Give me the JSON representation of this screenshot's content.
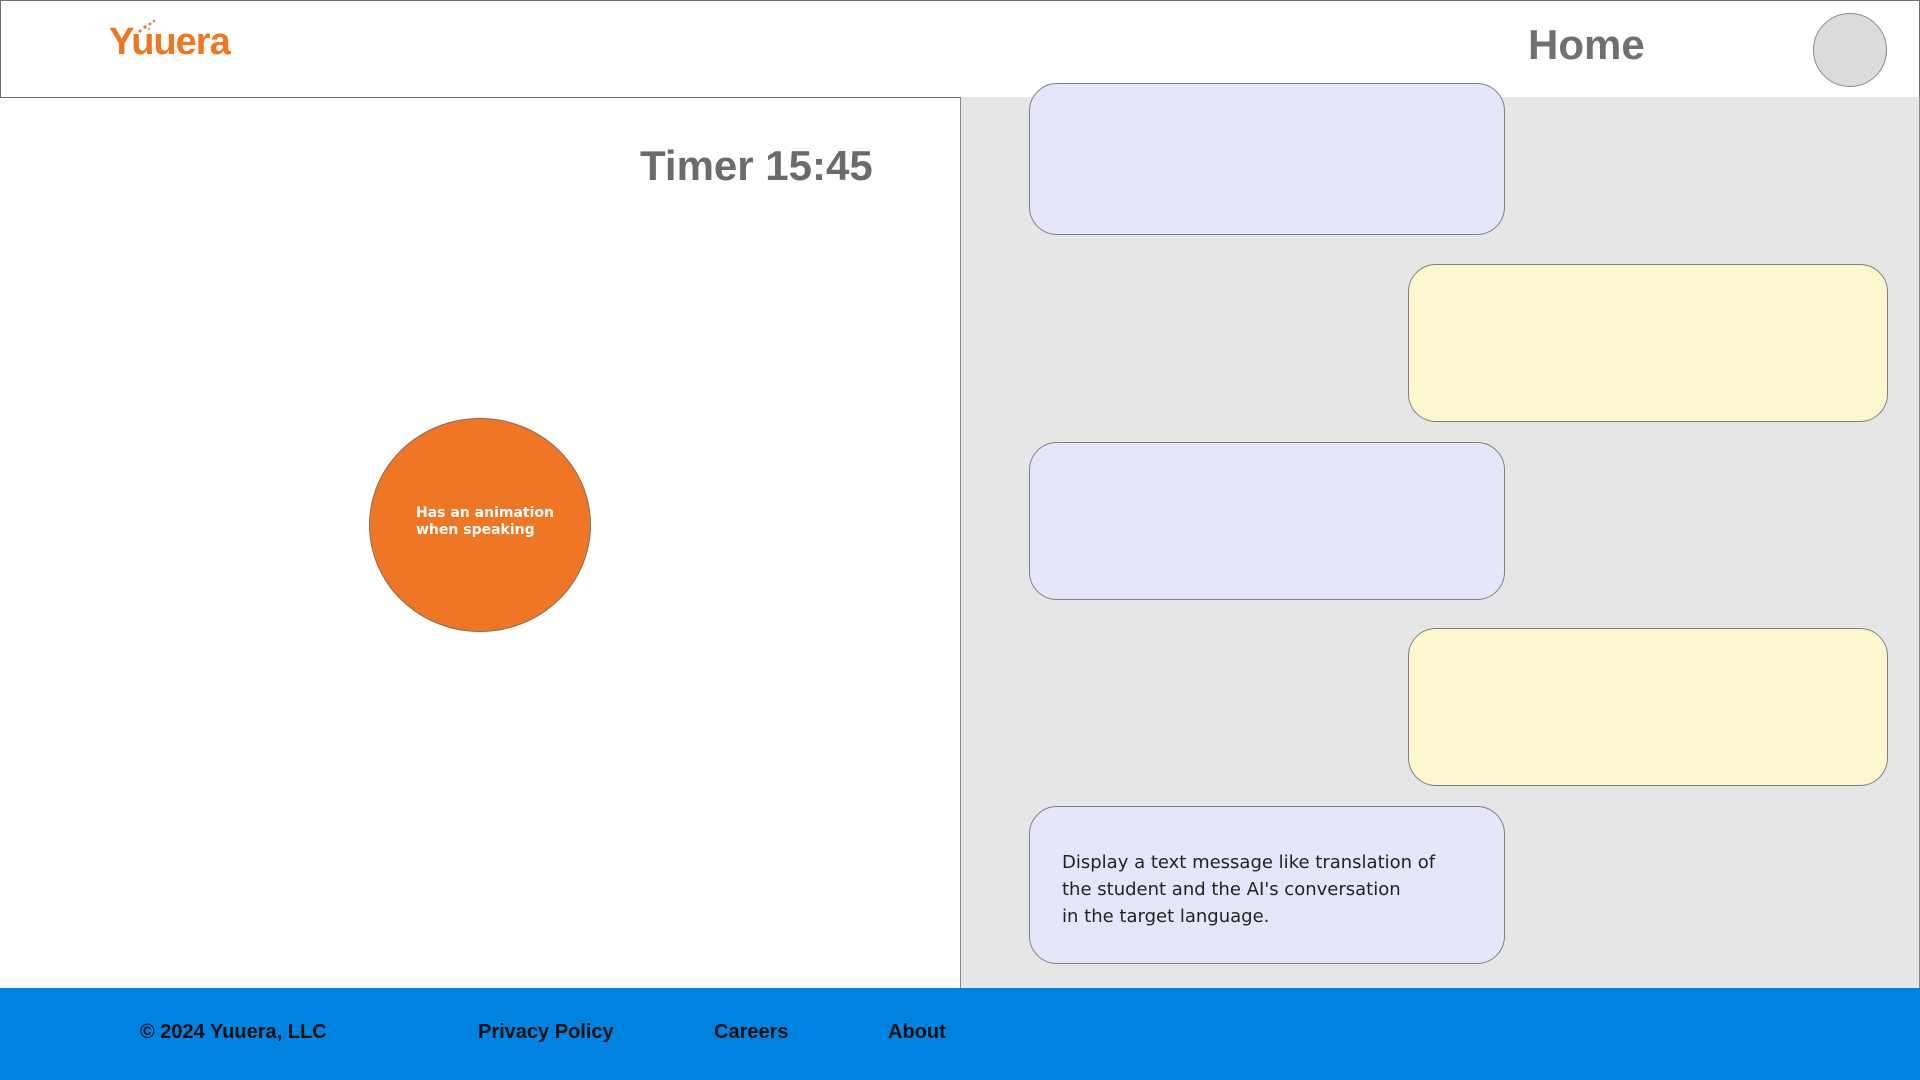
{
  "header": {
    "logo_text": "Yuuera",
    "title": "Home"
  },
  "session": {
    "timer": "Timer 15:45",
    "speaker_note": "Has an animation\nwhen speaking"
  },
  "chat": {
    "messages": [
      {
        "role": "ai",
        "text": ""
      },
      {
        "role": "user",
        "text": ""
      },
      {
        "role": "ai",
        "text": ""
      },
      {
        "role": "user",
        "text": ""
      },
      {
        "role": "ai",
        "text": "Display a text message like translation of\nthe student and the AI's conversation\nin the target language."
      }
    ]
  },
  "footer": {
    "copyright": "© 2024 Yuuera, LLC",
    "privacy": "Privacy Policy",
    "careers": "Careers",
    "about": "About"
  },
  "colors": {
    "brand_orange": "#ee7624",
    "footer_blue": "#0082e0",
    "ai_bubble": "#e6e6fb",
    "user_bubble": "#fcf7ce",
    "chat_background": "#e6e6e6"
  }
}
